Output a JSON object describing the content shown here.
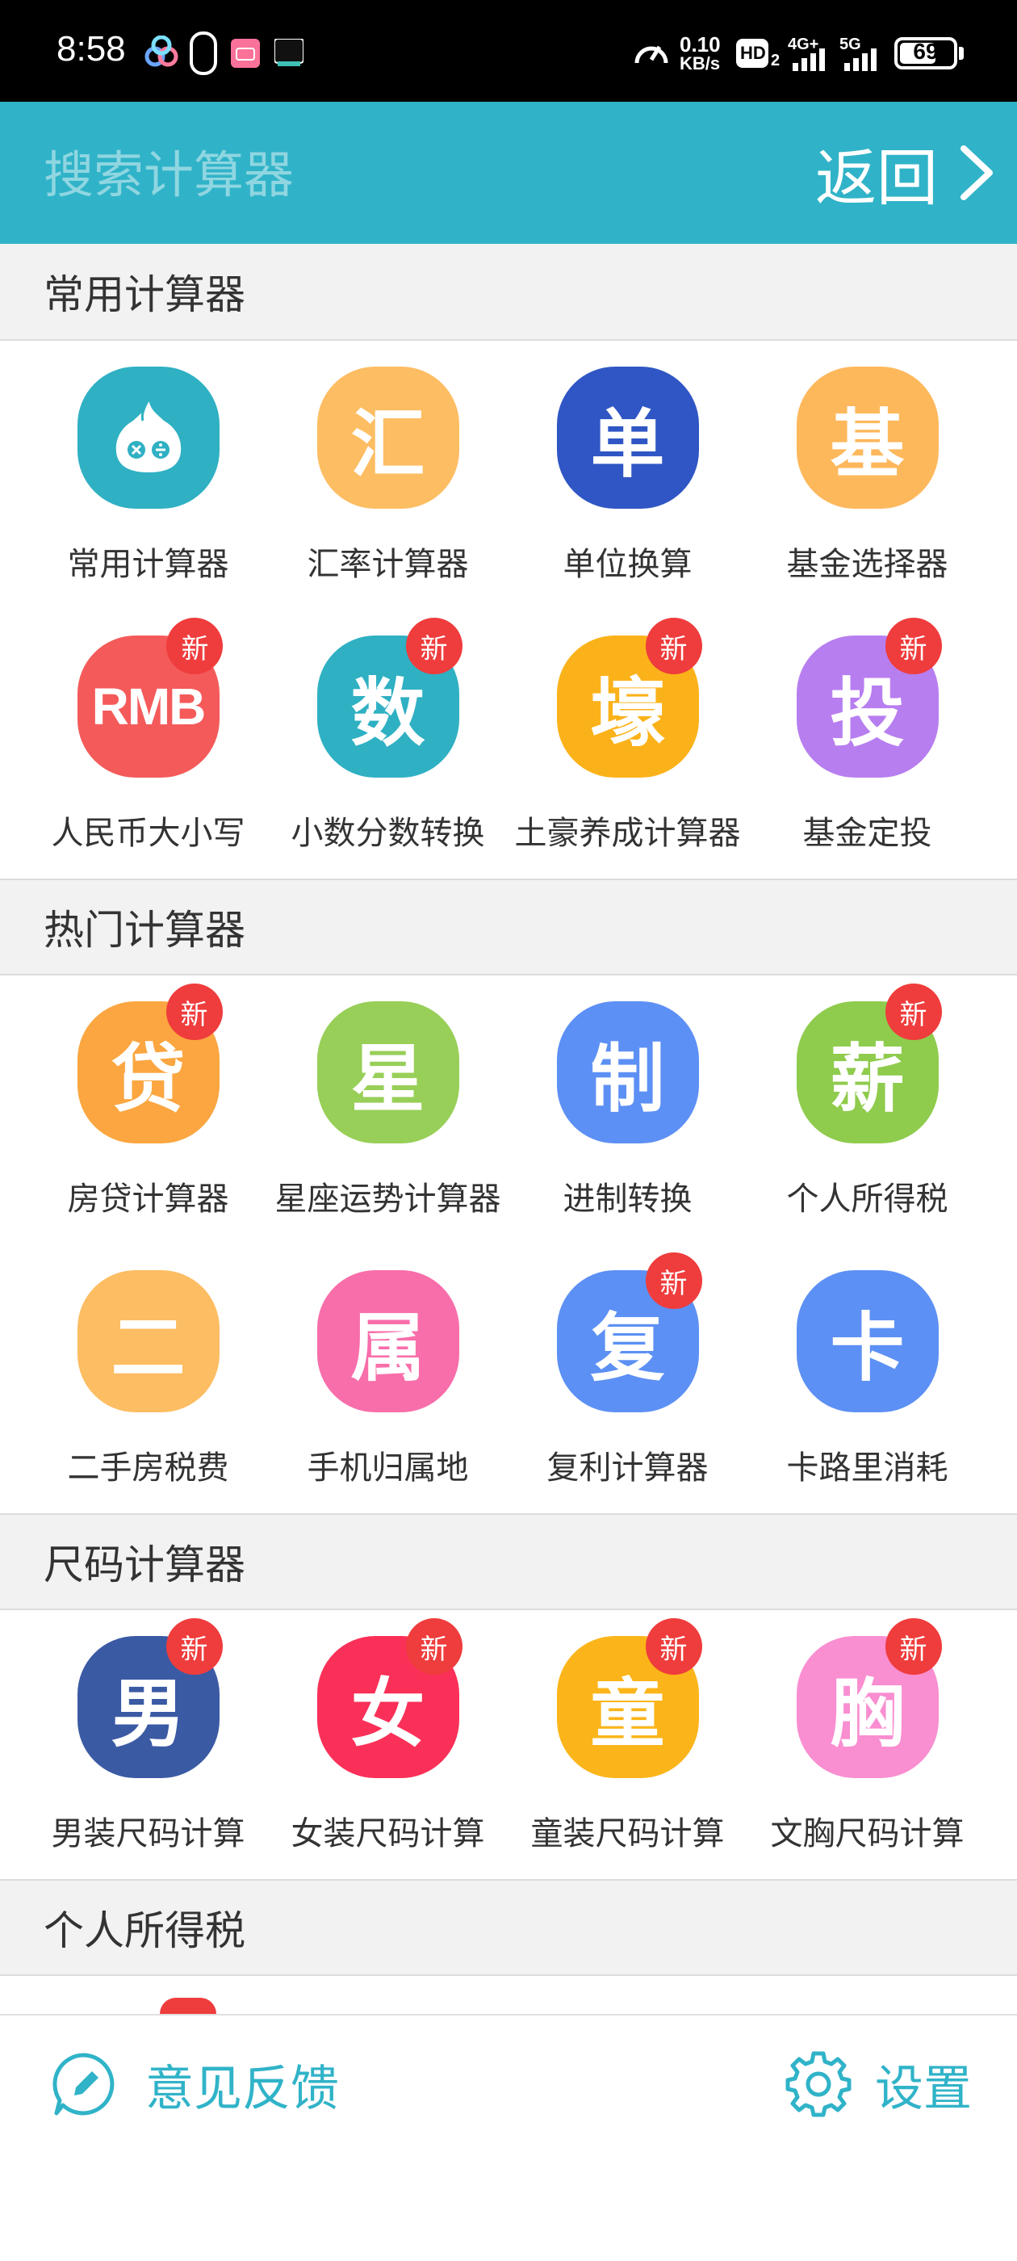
{
  "status_bar": {
    "time": "8:58",
    "speed_value": "0.10",
    "speed_unit": "KB/s",
    "hd": "HD",
    "hd_sub": "2",
    "net1": "4G+",
    "net2": "5G",
    "battery": "69",
    "battery_level": 0.69
  },
  "header": {
    "search_placeholder": "搜索计算器",
    "back_label": "返回"
  },
  "sections": [
    {
      "title": "常用计算器",
      "items": [
        {
          "label": "常用计算器",
          "glyph": "",
          "icon": "onion-calculator-icon",
          "color": "#2fb0c3",
          "is_new": false
        },
        {
          "label": "汇率计算器",
          "glyph": "汇",
          "icon": "exchange-rate-icon",
          "color": "#fdbd62",
          "is_new": false
        },
        {
          "label": "单位换算",
          "glyph": "单",
          "icon": "unit-conversion-icon",
          "color": "#2f56c4",
          "is_new": false
        },
        {
          "label": "基金选择器",
          "glyph": "基",
          "icon": "fund-selector-icon",
          "color": "#fdb85c",
          "is_new": false
        },
        {
          "label": "人民币大小写",
          "glyph": "RMB",
          "icon": "rmb-icon",
          "color": "#f45a5a",
          "is_new": true
        },
        {
          "label": "小数分数转换",
          "glyph": "数",
          "icon": "decimal-fraction-icon",
          "color": "#2fb0c3",
          "is_new": true
        },
        {
          "label": "土豪养成计算器",
          "glyph": "壕",
          "icon": "tuhao-icon",
          "color": "#fbb21a",
          "is_new": true
        },
        {
          "label": "基金定投",
          "glyph": "投",
          "icon": "fund-investment-icon",
          "color": "#b77ef0",
          "is_new": true
        }
      ]
    },
    {
      "title": "热门计算器",
      "items": [
        {
          "label": "房贷计算器",
          "glyph": "贷",
          "icon": "mortgage-icon",
          "color": "#fba640",
          "is_new": true
        },
        {
          "label": "星座运势计算器",
          "glyph": "星",
          "icon": "horoscope-icon",
          "color": "#98cf58",
          "is_new": false
        },
        {
          "label": "进制转换",
          "glyph": "制",
          "icon": "base-conversion-icon",
          "color": "#5d90f4",
          "is_new": false
        },
        {
          "label": "个人所得税",
          "glyph": "薪",
          "icon": "income-tax-icon",
          "color": "#8fcb4d",
          "is_new": true
        },
        {
          "label": "二手房税费",
          "glyph": "二",
          "icon": "second-hand-house-icon",
          "color": "#fdbd62",
          "is_new": false
        },
        {
          "label": "手机归属地",
          "glyph": "属",
          "icon": "phone-location-icon",
          "color": "#f86eaa",
          "is_new": false
        },
        {
          "label": "复利计算器",
          "glyph": "复",
          "icon": "compound-interest-icon",
          "color": "#5d90f4",
          "is_new": true
        },
        {
          "label": "卡路里消耗",
          "glyph": "卡",
          "icon": "calorie-icon",
          "color": "#5d90f4",
          "is_new": false
        }
      ]
    },
    {
      "title": "尺码计算器",
      "items": [
        {
          "label": "男装尺码计算",
          "glyph": "男",
          "icon": "mens-size-icon",
          "color": "#3b5aa4",
          "is_new": true
        },
        {
          "label": "女装尺码计算",
          "glyph": "女",
          "icon": "womens-size-icon",
          "color": "#fa3058",
          "is_new": true
        },
        {
          "label": "童装尺码计算",
          "glyph": "童",
          "icon": "kids-size-icon",
          "color": "#fbb51a",
          "is_new": true
        },
        {
          "label": "文胸尺码计算",
          "glyph": "胸",
          "icon": "bra-size-icon",
          "color": "#f98ed1",
          "is_new": true
        }
      ]
    },
    {
      "title": "个人所得税",
      "items": []
    }
  ],
  "badge_text": "新",
  "bottom_bar": {
    "feedback_label": "意见反馈",
    "settings_label": "设置"
  },
  "colors": {
    "accent": "#30b3c8",
    "badge": "#ef3c3c"
  }
}
